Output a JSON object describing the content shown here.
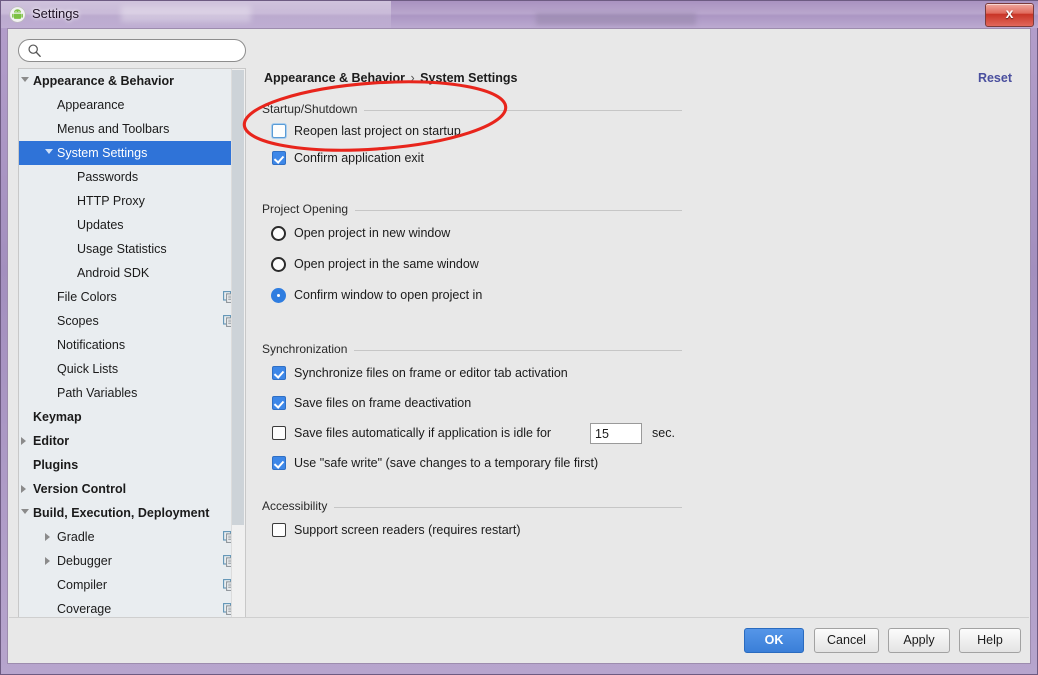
{
  "window": {
    "title": "Settings",
    "app_icon": "android-robot-icon",
    "close_label": "x",
    "accent_title_bar": "#b09ac6"
  },
  "search": {
    "value": "",
    "placeholder": "",
    "icon": "search-icon"
  },
  "sidebar": {
    "items": [
      {
        "label": "Appearance & Behavior",
        "indent": 0,
        "bold": true,
        "arrow": "expanded",
        "selected": false,
        "copy_icon": false
      },
      {
        "label": "Appearance",
        "indent": 1,
        "bold": false,
        "arrow": "none",
        "selected": false,
        "copy_icon": false
      },
      {
        "label": "Menus and Toolbars",
        "indent": 1,
        "bold": false,
        "arrow": "none",
        "selected": false,
        "copy_icon": false
      },
      {
        "label": "System Settings",
        "indent": 1,
        "bold": false,
        "arrow": "expanded",
        "selected": true,
        "copy_icon": false
      },
      {
        "label": "Passwords",
        "indent": 2,
        "bold": false,
        "arrow": "none",
        "selected": false,
        "copy_icon": false
      },
      {
        "label": "HTTP Proxy",
        "indent": 2,
        "bold": false,
        "arrow": "none",
        "selected": false,
        "copy_icon": false
      },
      {
        "label": "Updates",
        "indent": 2,
        "bold": false,
        "arrow": "none",
        "selected": false,
        "copy_icon": false
      },
      {
        "label": "Usage Statistics",
        "indent": 2,
        "bold": false,
        "arrow": "none",
        "selected": false,
        "copy_icon": false
      },
      {
        "label": "Android SDK",
        "indent": 2,
        "bold": false,
        "arrow": "none",
        "selected": false,
        "copy_icon": false
      },
      {
        "label": "File Colors",
        "indent": 1,
        "bold": false,
        "arrow": "none",
        "selected": false,
        "copy_icon": true
      },
      {
        "label": "Scopes",
        "indent": 1,
        "bold": false,
        "arrow": "none",
        "selected": false,
        "copy_icon": true
      },
      {
        "label": "Notifications",
        "indent": 1,
        "bold": false,
        "arrow": "none",
        "selected": false,
        "copy_icon": false
      },
      {
        "label": "Quick Lists",
        "indent": 1,
        "bold": false,
        "arrow": "none",
        "selected": false,
        "copy_icon": false
      },
      {
        "label": "Path Variables",
        "indent": 1,
        "bold": false,
        "arrow": "none",
        "selected": false,
        "copy_icon": false
      },
      {
        "label": "Keymap",
        "indent": 0,
        "bold": true,
        "arrow": "none",
        "selected": false,
        "copy_icon": false
      },
      {
        "label": "Editor",
        "indent": 0,
        "bold": true,
        "arrow": "collapsed",
        "selected": false,
        "copy_icon": false
      },
      {
        "label": "Plugins",
        "indent": 0,
        "bold": true,
        "arrow": "none",
        "selected": false,
        "copy_icon": false
      },
      {
        "label": "Version Control",
        "indent": 0,
        "bold": true,
        "arrow": "collapsed",
        "selected": false,
        "copy_icon": false
      },
      {
        "label": "Build, Execution, Deployment",
        "indent": 0,
        "bold": true,
        "arrow": "expanded",
        "selected": false,
        "copy_icon": false
      },
      {
        "label": "Gradle",
        "indent": 1,
        "bold": false,
        "arrow": "collapsed",
        "selected": false,
        "copy_icon": true
      },
      {
        "label": "Debugger",
        "indent": 1,
        "bold": false,
        "arrow": "collapsed",
        "selected": false,
        "copy_icon": true
      },
      {
        "label": "Compiler",
        "indent": 1,
        "bold": false,
        "arrow": "none",
        "selected": false,
        "copy_icon": true
      },
      {
        "label": "Coverage",
        "indent": 1,
        "bold": false,
        "arrow": "none",
        "selected": false,
        "copy_icon": true
      }
    ]
  },
  "content": {
    "breadcrumb_root": "Appearance & Behavior",
    "breadcrumb_sep": "›",
    "breadcrumb_leaf": "System Settings",
    "reset_label": "Reset",
    "sections": {
      "startup": {
        "title": "Startup/Shutdown",
        "options": [
          {
            "type": "checkbox",
            "label": "Reopen last project on startup",
            "checked": false,
            "focused": true
          },
          {
            "type": "checkbox",
            "label": "Confirm application exit",
            "checked": true,
            "focused": false
          }
        ]
      },
      "project_opening": {
        "title": "Project Opening",
        "options": [
          {
            "type": "radio",
            "label": "Open project in new window",
            "checked": false
          },
          {
            "type": "radio",
            "label": "Open project in the same window",
            "checked": false
          },
          {
            "type": "radio",
            "label": "Confirm window to open project in",
            "checked": true
          }
        ]
      },
      "synchronization": {
        "title": "Synchronization",
        "options": [
          {
            "type": "checkbox",
            "label": "Synchronize files on frame or editor tab activation",
            "checked": true
          },
          {
            "type": "checkbox",
            "label": "Save files on frame deactivation",
            "checked": true
          },
          {
            "type": "checkbox",
            "label": "Save files automatically if application is idle for",
            "checked": false
          },
          {
            "type": "checkbox",
            "label": "Use \"safe write\" (save changes to a temporary file first)",
            "checked": true
          }
        ],
        "idle_seconds_value": "15",
        "idle_seconds_unit": "sec."
      },
      "accessibility": {
        "title": "Accessibility",
        "options": [
          {
            "type": "checkbox",
            "label": "Support screen readers (requires restart)",
            "checked": false
          }
        ]
      }
    }
  },
  "buttons": {
    "ok": "OK",
    "cancel": "Cancel",
    "apply": "Apply",
    "help": "Help"
  },
  "annotation": {
    "shape": "ellipse",
    "color": "#e8251c",
    "target": "Reopen last project on startup"
  }
}
